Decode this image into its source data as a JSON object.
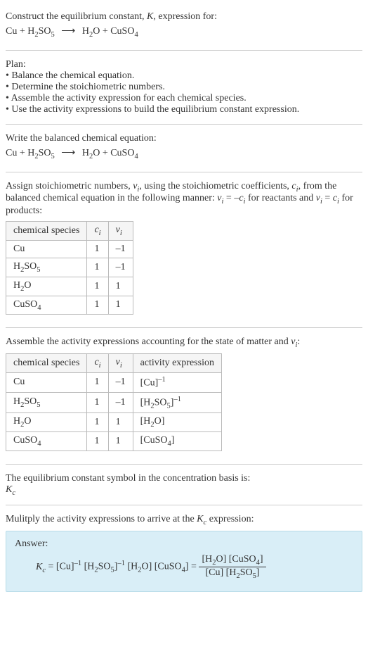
{
  "title": "Construct the equilibrium constant, K, expression for:",
  "main_equation": {
    "reactants": "Cu + H₂SO₅",
    "arrow": "⟶",
    "products": "H₂O + CuSO₄"
  },
  "plan": {
    "heading": "Plan:",
    "items": [
      "Balance the chemical equation.",
      "Determine the stoichiometric numbers.",
      "Assemble the activity expression for each chemical species.",
      "Use the activity expressions to build the equilibrium constant expression."
    ]
  },
  "balanced": {
    "heading": "Write the balanced chemical equation:",
    "reactants": "Cu + H₂SO₅",
    "arrow": "⟶",
    "products": "H₂O + CuSO₄"
  },
  "stoich": {
    "intro_a": "Assign stoichiometric numbers, ",
    "nu_i": "νᵢ",
    "intro_b": ", using the stoichiometric coefficients, ",
    "c_i": "cᵢ",
    "intro_c": ", from the balanced chemical equation in the following manner: ",
    "rule1": "νᵢ = –cᵢ",
    "intro_d": " for reactants and ",
    "rule2": "νᵢ = cᵢ",
    "intro_e": " for products:",
    "headers": [
      "chemical species",
      "cᵢ",
      "νᵢ"
    ],
    "rows": [
      [
        "Cu",
        "1",
        "–1"
      ],
      [
        "H₂SO₅",
        "1",
        "–1"
      ],
      [
        "H₂O",
        "1",
        "1"
      ],
      [
        "CuSO₄",
        "1",
        "1"
      ]
    ]
  },
  "activity": {
    "intro_a": "Assemble the activity expressions accounting for the state of matter and ",
    "nu_i": "νᵢ",
    "intro_b": ":",
    "headers": [
      "chemical species",
      "cᵢ",
      "νᵢ",
      "activity expression"
    ],
    "rows": [
      [
        "Cu",
        "1",
        "–1",
        "[Cu]⁻¹"
      ],
      [
        "H₂SO₅",
        "1",
        "–1",
        "[H₂SO₅]⁻¹"
      ],
      [
        "H₂O",
        "1",
        "1",
        "[H₂O]"
      ],
      [
        "CuSO₄",
        "1",
        "1",
        "[CuSO₄]"
      ]
    ]
  },
  "symbol": {
    "text": "The equilibrium constant symbol in the concentration basis is:",
    "value": "K_c"
  },
  "multiply": {
    "text": "Mulitply the activity expressions to arrive at the K_c expression:"
  },
  "answer": {
    "label": "Answer:",
    "lhs": "K_c = [Cu]⁻¹ [H₂SO₅]⁻¹ [H₂O] [CuSO₄] =",
    "frac_num": "[H₂O] [CuSO₄]",
    "frac_den": "[Cu] [H₂SO₅]"
  }
}
